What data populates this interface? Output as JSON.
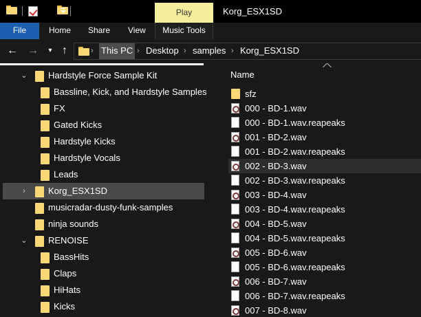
{
  "window": {
    "title": "Korg_ESX1SD",
    "contextual_tab": "Play"
  },
  "ribbon": {
    "tabs": [
      {
        "label": "File"
      },
      {
        "label": "Home"
      },
      {
        "label": "Share"
      },
      {
        "label": "View"
      },
      {
        "label": "Music Tools"
      }
    ]
  },
  "address": {
    "back_icon": "arrow-left-icon",
    "forward_icon": "arrow-right-icon",
    "recent_icon": "chevron-down-icon",
    "up_icon": "arrow-up-icon",
    "crumbs": [
      "This PC",
      "Desktop",
      "samples",
      "Korg_ESX1SD"
    ]
  },
  "tree": {
    "items": [
      {
        "label": "Hardstyle Force Sample Kit",
        "expanded": true
      },
      {
        "label": "Bassline, Kick, and Hardstyle Samples"
      },
      {
        "label": "FX"
      },
      {
        "label": "Gated Kicks"
      },
      {
        "label": "Hardstyle Kicks"
      },
      {
        "label": "Hardstyle Vocals"
      },
      {
        "label": "Leads"
      },
      {
        "label": "Korg_ESX1SD",
        "selected": true,
        "collapsed": true
      },
      {
        "label": "musicradar-dusty-funk-samples"
      },
      {
        "label": "ninja sounds"
      },
      {
        "label": "RENOISE",
        "expanded": true
      },
      {
        "label": "BassHits"
      },
      {
        "label": "Claps"
      },
      {
        "label": "HiHats"
      },
      {
        "label": "Kicks"
      }
    ]
  },
  "file_list": {
    "column_header": "Name",
    "items": [
      {
        "name": "sfz",
        "icon": "folder-icon"
      },
      {
        "name": "000 - BD-1.wav",
        "icon": "wav-file-icon"
      },
      {
        "name": "000 - BD-1.wav.reapeaks",
        "icon": "file-icon"
      },
      {
        "name": "001 - BD-2.wav",
        "icon": "wav-file-icon"
      },
      {
        "name": "001 - BD-2.wav.reapeaks",
        "icon": "file-icon"
      },
      {
        "name": "002 - BD-3.wav",
        "icon": "wav-file-icon",
        "hover": true
      },
      {
        "name": "002 - BD-3.wav.reapeaks",
        "icon": "file-icon"
      },
      {
        "name": "003 - BD-4.wav",
        "icon": "wav-file-icon"
      },
      {
        "name": "003 - BD-4.wav.reapeaks",
        "icon": "file-icon"
      },
      {
        "name": "004 - BD-5.wav",
        "icon": "wav-file-icon"
      },
      {
        "name": "004 - BD-5.wav.reapeaks",
        "icon": "file-icon"
      },
      {
        "name": "005 - BD-6.wav",
        "icon": "wav-file-icon"
      },
      {
        "name": "005 - BD-6.wav.reapeaks",
        "icon": "file-icon"
      },
      {
        "name": "006 - BD-7.wav",
        "icon": "wav-file-icon"
      },
      {
        "name": "006 - BD-7.wav.reapeaks",
        "icon": "file-icon"
      },
      {
        "name": "007 - BD-8.wav",
        "icon": "wav-file-icon"
      }
    ]
  },
  "colors": {
    "accent_file_tab": "#1c5fb0",
    "contextual_tab": "#f5ef9b",
    "folder": "#f8d775",
    "selection": "#4a4a4a",
    "background": "#191919"
  }
}
